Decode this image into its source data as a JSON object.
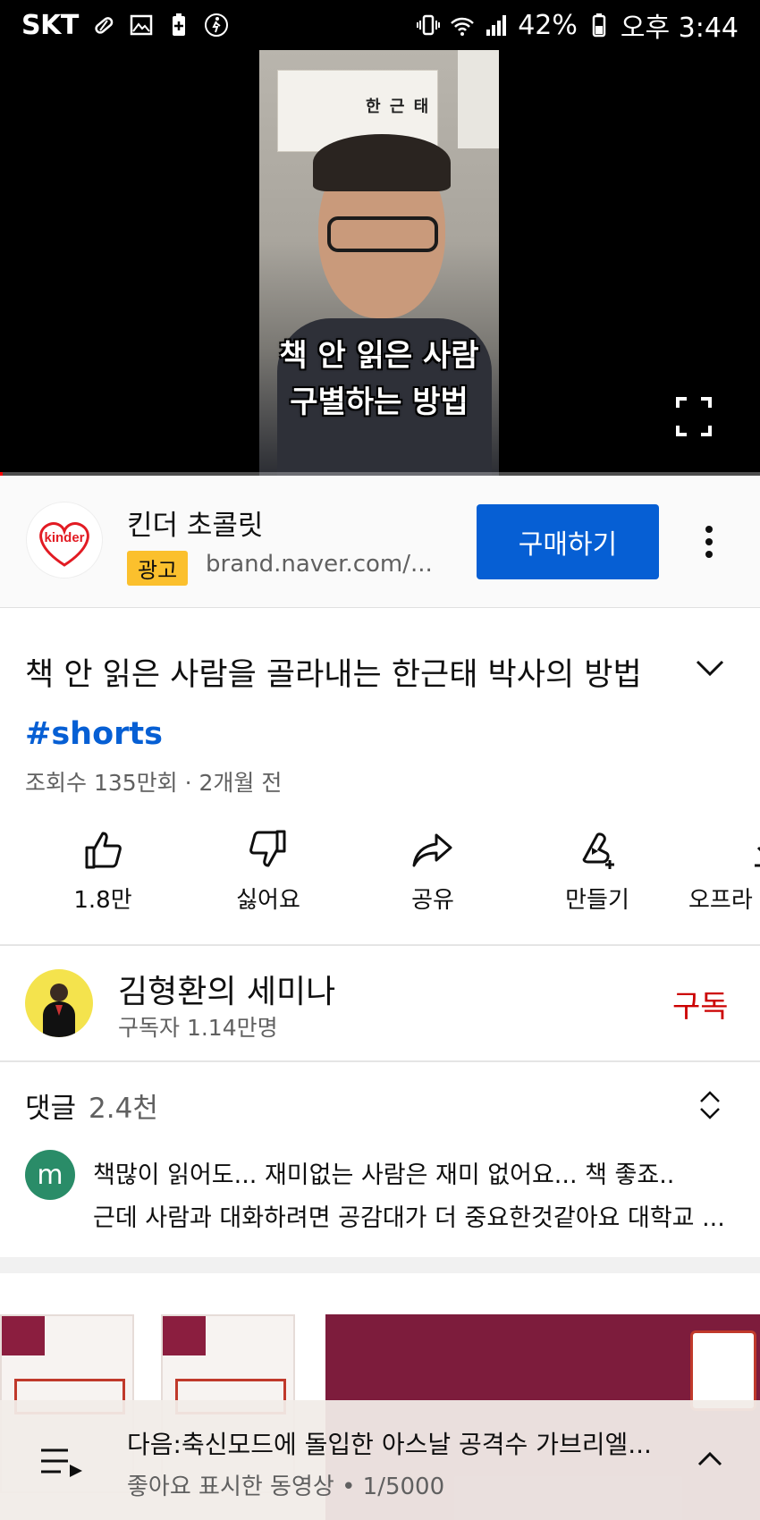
{
  "status_bar": {
    "carrier": "SKT",
    "battery": "42%",
    "time": "오후 3:44"
  },
  "video": {
    "caption_line1": "책 안 읽은 사람",
    "caption_line2": "구별하는 방법",
    "poster_name": "한 근 태",
    "progress_fraction": 0.004
  },
  "ad": {
    "advertiser": "킨더 초콜릿",
    "badge": "광고",
    "url": "brand.naver.com/...",
    "cta": "구매하기",
    "logo_text": "kinder"
  },
  "video_info": {
    "title": "책 안 읽은 사람을 골라내는 한근태 박사의 방법",
    "hashtag": "#shorts",
    "meta": "조회수 135만회 · 2개월 전"
  },
  "actions": {
    "like": "1.8만",
    "dislike": "싫어요",
    "share": "공유",
    "remix": "만들기",
    "offline": "오프라"
  },
  "channel": {
    "name": "김형환의 세미나",
    "subscribers": "구독자 1.14만명",
    "subscribe": "구독"
  },
  "comments": {
    "label": "댓글",
    "count": "2.4천",
    "avatar_letter": "m",
    "line1": "책많이 읽어도... 재미없는 사람은 재미 없어요... 책 좋죠..",
    "line2": "근데 사람과 대화하려면 공감대가 더 중요한것같아요 대학교 ..."
  },
  "next_up": {
    "title": "다음:축신모드에 돌입한 아스날 공격수 가브리엘...",
    "subtitle": "좋아요 표시한 동영상 • 1/5000"
  },
  "colors": {
    "accent_blue": "#065fd4",
    "subscribe_red": "#cc0000",
    "ad_badge": "#fbc02d",
    "comment_avatar": "#2a8c68"
  }
}
